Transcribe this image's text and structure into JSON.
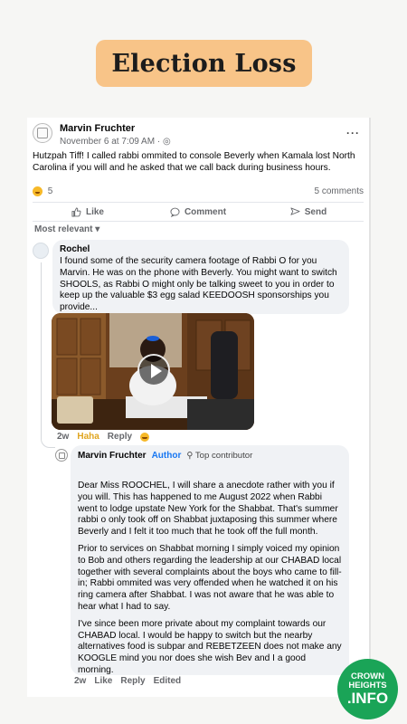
{
  "badge_title": "Election Loss",
  "post": {
    "author": "Marvin Fruchter",
    "meta": "November 6 at 7:09 AM · ◎",
    "more": "···",
    "text": "Hutzpah Tiff! I called rabbi ommited to console Beverly when Kamala lost North Carolina if you will and he asked that we call back during business hours.",
    "reaction_count": "5",
    "comment_count": "5 comments"
  },
  "actions": {
    "like": "Like",
    "comment": "Comment",
    "send": "Send"
  },
  "sort_label": "Most relevant ▾",
  "comment1": {
    "author": "Rochel",
    "text": "I found some of the security camera footage of Rabbi O for you Marvin. He was on the phone with Beverly. You might want to switch SHOOLS, as Rabbi O might only be talking sweet to you in order to keep up the valuable $3 egg salad KEEDOOSH sponsorships you provide...",
    "time": "2w",
    "reaction": "Haha",
    "reply": "Reply"
  },
  "comment2": {
    "author": "Marvin Fruchter",
    "badge_author": "Author",
    "badge_top": "⚲ Top contributor",
    "para1": "Dear Miss ROOCHEL, I will share a anecdote rather with you if you will. This has happened to me August 2022 when Rabbi went to lodge upstate New York for the Shabbat. That's summer rabbi o only took off on Shabbat juxtaposing this summer where Beverly and I felt it too much that he took off the full month.",
    "para2": "Prior to services on Shabbat morning I simply voiced my opinion to Bob and others regarding the leadership at our CHABAD local together with several complaints about the boys who came to fill-in; Rabbi ommited was very offended when he watched it on his ring camera after Shabbat. I was not aware that he was able to hear what I had to say.",
    "para3": "I've since been more private about my complaint towards our CHABAD local. I would be happy to switch but the nearby alternatives food is subpar and REBETZEEN does not make any KOOGLE mind you nor does she wish Bev and I a good morning.",
    "time": "2w",
    "like": "Like",
    "reply": "Reply",
    "edited": "Edited"
  },
  "logo": {
    "line1": "CROWN",
    "line2": "HEIGHTS",
    "line3": ".INFO"
  },
  "colors": {
    "badge": "#f8c488",
    "logo": "#1aa457",
    "author_blue": "#1877f2",
    "haha": "#e0a51f"
  }
}
